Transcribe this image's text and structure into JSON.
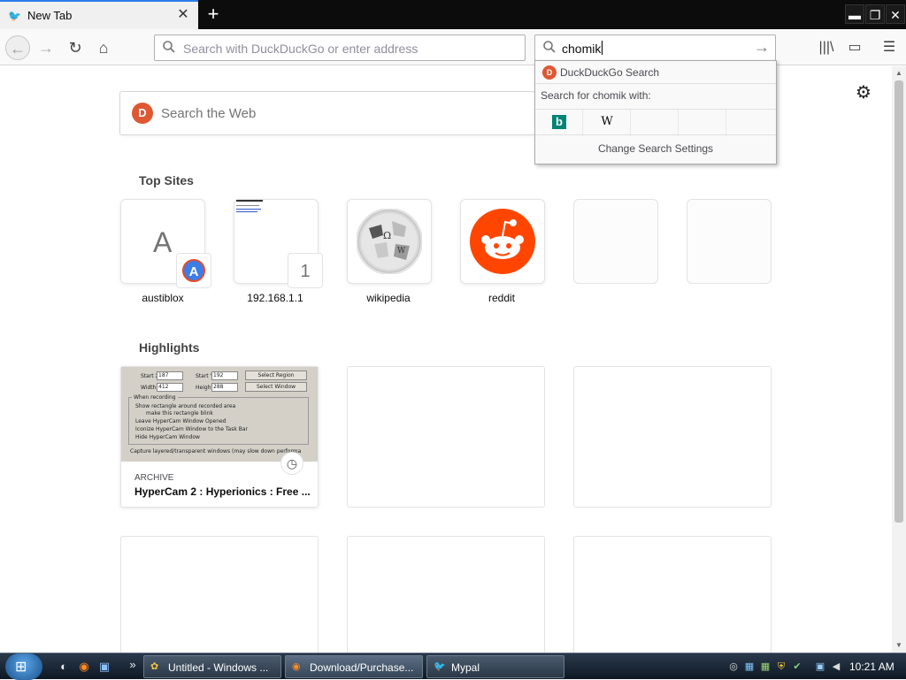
{
  "tab": {
    "title": "New Tab",
    "favicon": "bird-icon",
    "close": "✕"
  },
  "newtab_label": "+",
  "window": {
    "minimize": "▬",
    "restore": "❐",
    "close": "✕"
  },
  "nav": {
    "back": "←",
    "forward": "→",
    "reload": "↻",
    "home": "⌂",
    "url_placeholder": "Search with DuckDuckGo or enter address",
    "search_value": "chomik",
    "search_go": "→",
    "library": "|||\\",
    "sidebar": "▭",
    "menu": "☰"
  },
  "content": {
    "websearch_placeholder": "Search the Web",
    "ddg_badge": "D",
    "settings_icon": "⚙",
    "top_sites_title": "Top Sites",
    "top_sites": [
      {
        "label": "austiblox",
        "letter": "A",
        "badge": "A"
      },
      {
        "label": "192.168.1.1",
        "badge": "1"
      },
      {
        "label": "wikipedia"
      },
      {
        "label": "reddit"
      }
    ],
    "highlights_title": "Highlights",
    "highlight": {
      "tag": "ARCHIVE",
      "title": "HyperCam 2 : Hyperionics : Free ..."
    },
    "hypercam": {
      "startx_label": "Start X",
      "startx": "187",
      "starty_label": "Start Y",
      "starty": "192",
      "width_label": "Width",
      "width": "412",
      "height_label": "Height",
      "height": "288",
      "select_region": "Select Region",
      "select_window": "Select Window",
      "when_recording": "When recording",
      "opt1": "Show rectangle around recorded area",
      "opt2": "make this rectangle blink",
      "opt3": "Leave HyperCam Window Opened",
      "opt4": "Iconize HyperCam Window to the Task Bar",
      "opt5": "Hide HyperCam Window",
      "capture": "Capture layered/transparent windows (may slow down performa"
    }
  },
  "dropdown": {
    "header": "DuckDuckGo Search",
    "search_for": "Search for chomik with:",
    "engines": [
      "bing-icon",
      "wikipedia-icon",
      "",
      ""
    ],
    "bing_glyph": "b",
    "wiki_glyph": "W",
    "change_settings": "Change Search Settings"
  },
  "taskbar": {
    "windows_flag": "⊞",
    "tasks": [
      {
        "label": "Untitled - Windows ...",
        "icon": "media-player-icon"
      },
      {
        "label": "Download/Purchase...",
        "icon": "firefox-icon"
      },
      {
        "label": "Mypal",
        "icon": "bird-icon"
      }
    ],
    "chevron": "»",
    "clock": "10:21 AM"
  }
}
